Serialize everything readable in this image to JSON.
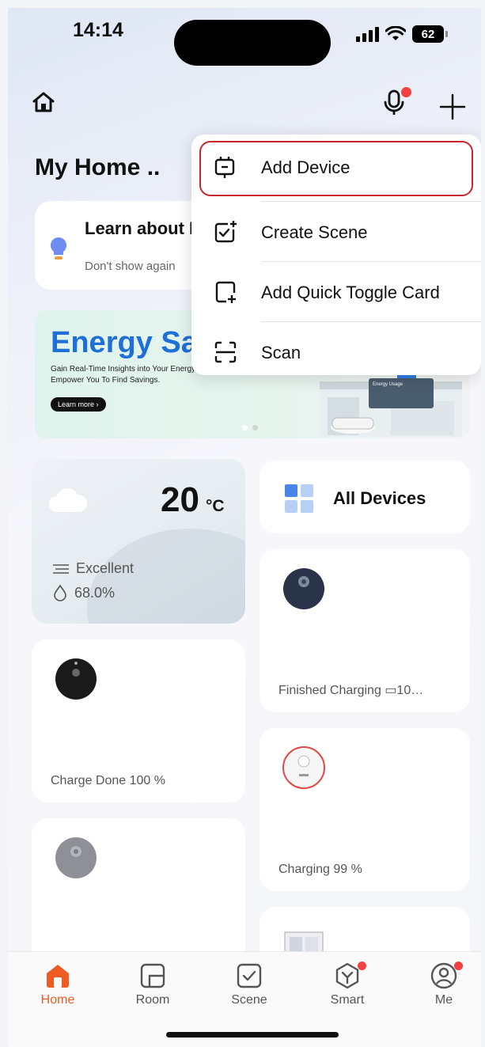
{
  "status_bar": {
    "time": "14:14",
    "battery": "62"
  },
  "header": {
    "title": "My Home .."
  },
  "learn_card": {
    "title": "Learn about DIY homepage",
    "subtitle": "Don't show again"
  },
  "banner": {
    "title": "Energy Saving",
    "description": "Gain Real-Time Insights into Your Energy Usage, Empower You To Find Savings.",
    "cta": "Learn more ›",
    "badge": "Energy Usage"
  },
  "weather": {
    "temperature": "20",
    "unit": "°C",
    "air_quality": "Excellent",
    "humidity": "68.0%"
  },
  "all_devices": {
    "label": "All Devices"
  },
  "devices": [
    {
      "status": "Finished Charging  ▭10…",
      "battery_prefix": "▯▯"
    },
    {
      "status": "Charge Done  100 %"
    },
    {
      "status": "Charging  99 %"
    },
    {
      "status": ""
    },
    {
      "status": ""
    }
  ],
  "menu": {
    "items": [
      {
        "label": "Add Device",
        "icon": "add-device-icon"
      },
      {
        "label": "Create Scene",
        "icon": "create-scene-icon"
      },
      {
        "label": "Add Quick Toggle Card",
        "icon": "add-card-icon"
      },
      {
        "label": "Scan",
        "icon": "scan-icon"
      }
    ]
  },
  "tabs": [
    {
      "label": "Home",
      "active": true
    },
    {
      "label": "Room"
    },
    {
      "label": "Scene"
    },
    {
      "label": "Smart",
      "badge": true
    },
    {
      "label": "Me",
      "badge": true
    }
  ],
  "colors": {
    "accent": "#f05a24",
    "badge": "#f04040",
    "highlight": "#c9262d",
    "banner_title": "#1f6fd8"
  }
}
